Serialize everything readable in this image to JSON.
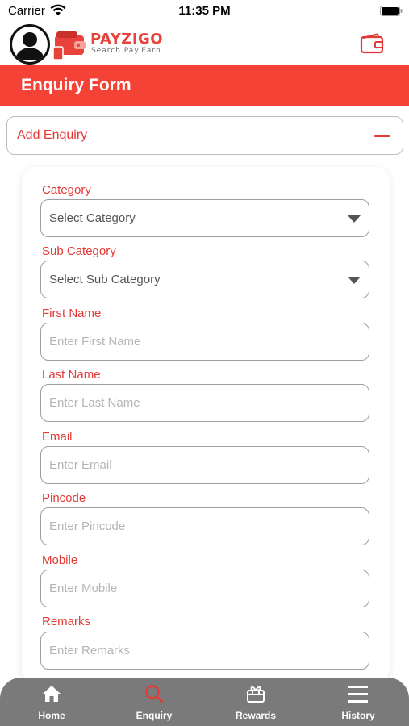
{
  "status_bar": {
    "carrier": "Carrier",
    "time": "11:35 PM"
  },
  "header": {
    "logo_name": "PAYZIGO",
    "logo_tagline": "Search.Pay.Earn",
    "wallet_icon": "wallet-icon",
    "avatar_icon": "user-avatar-icon"
  },
  "title": "Enquiry Form",
  "accordion": {
    "label": "Add Enquiry",
    "icon": "minus-icon"
  },
  "form": {
    "category": {
      "label": "Category",
      "value": "Select Category"
    },
    "sub_category": {
      "label": "Sub Category",
      "value": "Select Sub Category"
    },
    "first_name": {
      "label": "First Name",
      "placeholder": "Enter First Name"
    },
    "last_name": {
      "label": "Last Name",
      "placeholder": "Enter Last Name"
    },
    "email": {
      "label": "Email",
      "placeholder": "Enter Email"
    },
    "pincode": {
      "label": "Pincode",
      "placeholder": "Enter Pincode"
    },
    "mobile": {
      "label": "Mobile",
      "placeholder": "Enter Mobile"
    },
    "remarks": {
      "label": "Remarks",
      "placeholder": "Enter Remarks"
    }
  },
  "tabs": [
    {
      "label": "Home",
      "icon": "home-icon",
      "active": false
    },
    {
      "label": "Enquiry",
      "icon": "search-icon",
      "active": true
    },
    {
      "label": "Rewards",
      "icon": "gift-card-icon",
      "active": false
    },
    {
      "label": "History",
      "icon": "menu-icon",
      "active": false
    }
  ],
  "colors": {
    "accent": "#f44336",
    "label_red": "#e53935",
    "tab_bar": "#7a7a7a",
    "active_tab_icon": "#e53935"
  }
}
